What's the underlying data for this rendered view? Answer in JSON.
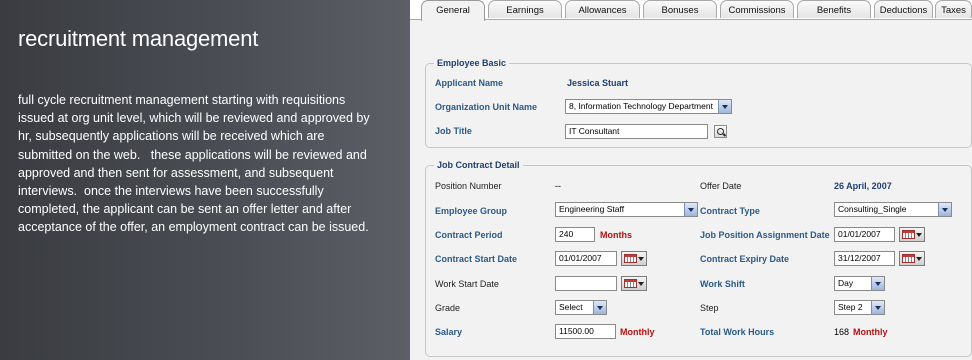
{
  "intro": {
    "heading": "recruitment management",
    "description": "full cycle recruitment management starting with requisitions issued at org unit level, which will be reviewed and approved by hr, subsequently applications will be received which are submitted on the web.   these applications will be reviewed and approved and then sent for assessment, and subsequent interviews.  once the interviews have been successfully completed, the applicant can be sent an offer letter and after acceptance of the offer, an employment contract can be issued."
  },
  "tabs": [
    {
      "label": "General",
      "active": true
    },
    {
      "label": "Earnings"
    },
    {
      "label": "Allowances"
    },
    {
      "label": "Bonuses"
    },
    {
      "label": "Commissions"
    },
    {
      "label": "Benefits"
    },
    {
      "label": "Deductions"
    },
    {
      "label": "Taxes"
    }
  ],
  "employee_basic": {
    "legend": "Employee Basic",
    "applicant_name_label": "Applicant Name",
    "applicant_name": "Jessica Stuart",
    "org_unit_label": "Organization Unit Name",
    "org_unit_value": "8, Information Technology Department",
    "job_title_label": "Job Title",
    "job_title_value": "IT Consultant"
  },
  "contract": {
    "legend": "Job Contract Detail",
    "position_number_label": "Position Number",
    "position_number": "--",
    "offer_date_label": "Offer Date",
    "offer_date": "26 April, 2007",
    "employee_group_label": "Employee Group",
    "employee_group_value": "Engineering Staff",
    "contract_type_label": "Contract Type",
    "contract_type_value": "Consulting_Single",
    "contract_period_label": "Contract Period",
    "contract_period_value": "240",
    "contract_period_unit": "Months",
    "assignment_date_label": "Job Position Assignment Date",
    "assignment_date_value": "01/01/2007",
    "contract_start_label": "Contract Start Date",
    "contract_start_value": "01/01/2007",
    "contract_expiry_label": "Contract Expiry Date",
    "contract_expiry_value": "31/12/2007",
    "work_start_label": "Work Start Date",
    "work_start_value": "",
    "work_shift_label": "Work Shift",
    "work_shift_value": "Day",
    "grade_label": "Grade",
    "grade_value": "Select",
    "step_label": "Step",
    "step_value": "Step 2",
    "salary_label": "Salary",
    "salary_value": "11500.00",
    "salary_unit": "Monthly",
    "total_hours_label": "Total Work Hours",
    "total_hours_value": "168",
    "total_hours_unit": "Monthly"
  }
}
